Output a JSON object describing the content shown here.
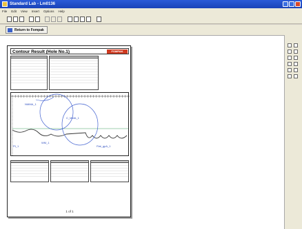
{
  "window": {
    "title": "Standard Lab - Lm0136",
    "accent": "#2b5bd8"
  },
  "menu": {
    "items": [
      "File",
      "Edit",
      "View",
      "Insert",
      "Options",
      "Help"
    ]
  },
  "toolbar": {
    "icons": [
      "new-icon",
      "open-icon",
      "save-icon",
      "print-icon",
      "preview-icon",
      "cut-icon",
      "copy-icon",
      "paste-icon",
      "grid-icon",
      "table-icon",
      "chart-icon",
      "info-icon",
      "help-icon"
    ]
  },
  "return_button": {
    "label": "Return to Fompak"
  },
  "report": {
    "title": "Contour Result (Hole No.1)",
    "badge": "FOMPAK",
    "page_label": "1 of 1"
  },
  "chart": {
    "labels": {
      "upper_left": "NMMA_1",
      "center": "C_MMA_1",
      "lower_left": "Pt_1",
      "lower_mid": "WM_1",
      "lower_right": "Flat_gpA_1"
    }
  },
  "colors": {
    "curve": "#4060d0",
    "profile": "#333333",
    "baseline": "#40a060",
    "badge": "#d03a20"
  }
}
